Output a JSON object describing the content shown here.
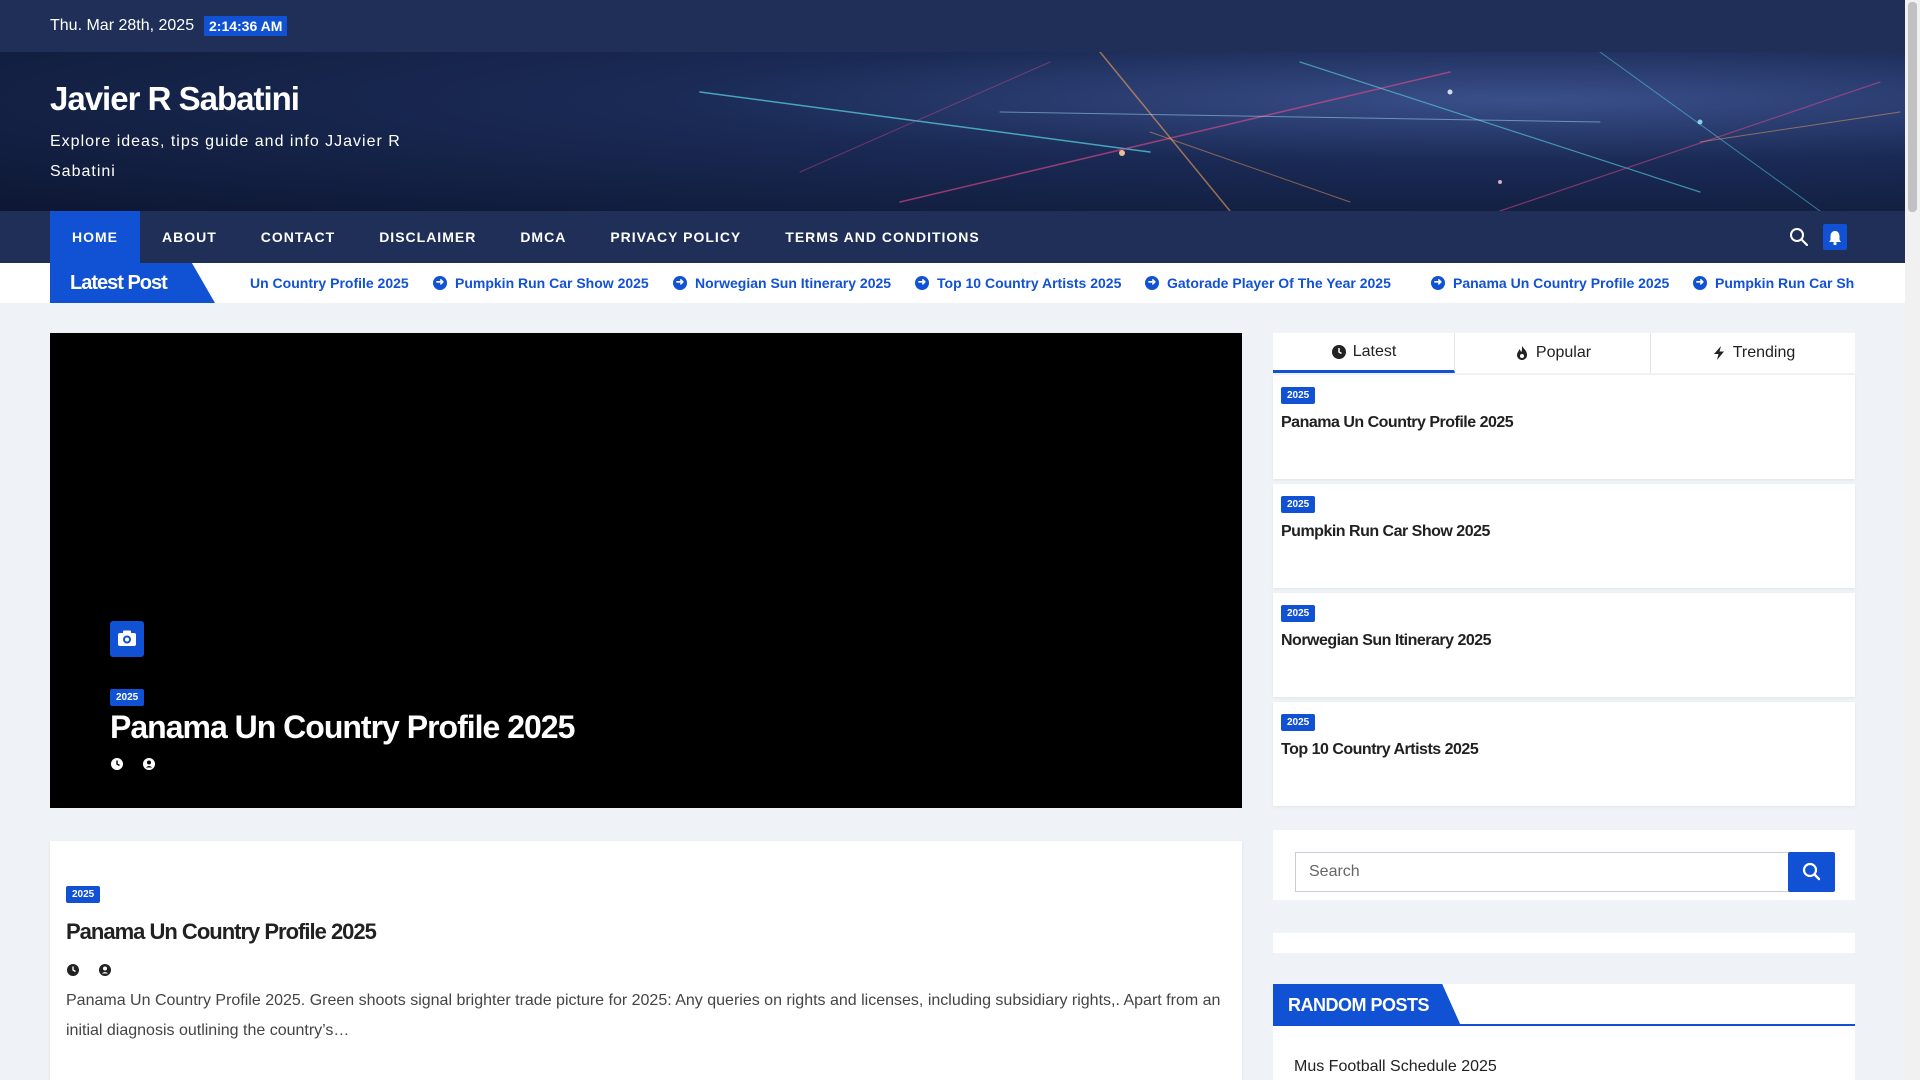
{
  "topbar": {
    "date": "Thu. Mar 28th, 2025",
    "time": "2:14:36 AM"
  },
  "site": {
    "title": "Javier R Sabatini",
    "tagline": "Explore ideas, tips guide and info JJavier R Sabatini"
  },
  "nav": {
    "items": [
      {
        "label": "HOME",
        "active": true
      },
      {
        "label": "ABOUT"
      },
      {
        "label": "CONTACT"
      },
      {
        "label": "DISCLAIMER"
      },
      {
        "label": "DMCA"
      },
      {
        "label": "PRIVACY POLICY"
      },
      {
        "label": "TERMS AND CONDITIONS"
      }
    ],
    "search_icon": "search-icon",
    "bell_icon": "bell-icon"
  },
  "ticker": {
    "label": "Latest Post",
    "items": [
      "Un Country Profile 2025",
      "Pumpkin Run Car Show 2025",
      "Norwegian Sun Itinerary 2025",
      "Top 10 Country Artists 2025",
      "Gatorade Player Of The Year 2025",
      "Panama Un Country Profile 2025",
      "Pumpkin Run Car Show 2025"
    ]
  },
  "hero": {
    "category": "2025",
    "title": "Panama Un Country Profile 2025"
  },
  "article": {
    "category": "2025",
    "title": "Panama Un Country Profile 2025",
    "excerpt": "Panama Un Country Profile 2025. Green shoots signal brighter trade picture for 2025: Any queries on rights and licenses, including subsidiary rights,. Apart from an initial diagnosis outlining the country’s…"
  },
  "sidebar": {
    "tabs": [
      {
        "label": "Latest",
        "icon": "clock-icon",
        "active": true
      },
      {
        "label": "Popular",
        "icon": "fire-icon"
      },
      {
        "label": "Trending",
        "icon": "bolt-icon"
      }
    ],
    "posts": [
      {
        "category": "2025",
        "title": "Panama Un Country Profile 2025"
      },
      {
        "category": "2025",
        "title": "Pumpkin Run Car Show 2025"
      },
      {
        "category": "2025",
        "title": "Norwegian Sun Itinerary 2025"
      },
      {
        "category": "2025",
        "title": "Top 10 Country Artists 2025"
      }
    ],
    "search_placeholder": "Search",
    "random": {
      "heading": "RANDOM POSTS",
      "first": "Mus Football Schedule 2025"
    }
  },
  "colors": {
    "primary": "#1151d3",
    "navy": "#1f2f57",
    "background": "#eff2f7"
  }
}
